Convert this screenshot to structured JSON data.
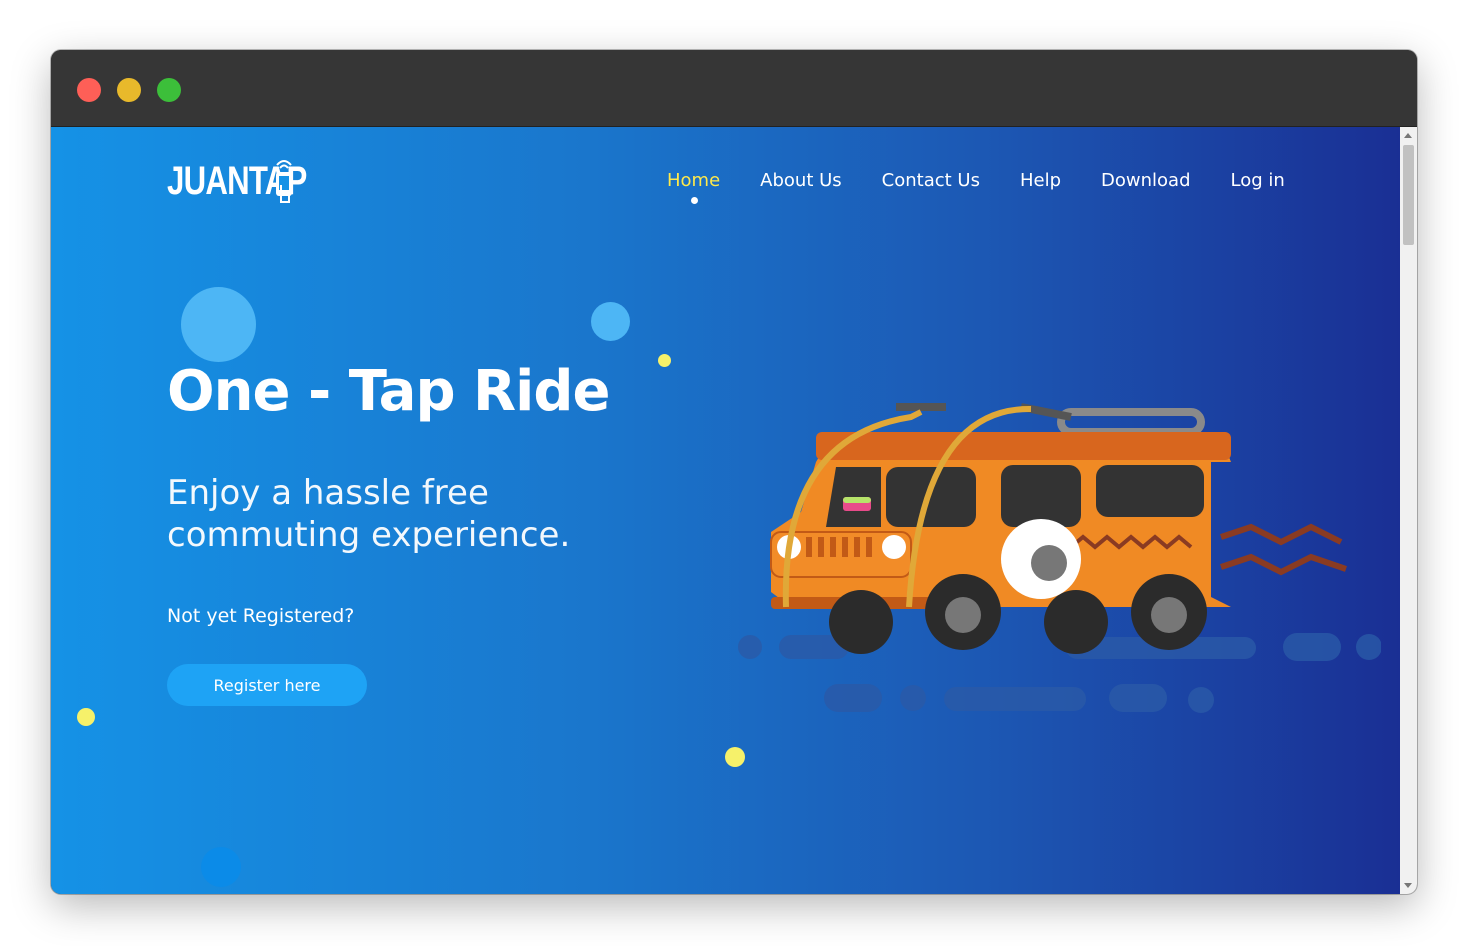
{
  "window": {
    "controls": [
      "close",
      "minimize",
      "maximize"
    ]
  },
  "brand": {
    "logo_text": "JUANTAP",
    "logo_icon": "tap-phone-icon"
  },
  "nav": {
    "items": [
      {
        "label": "Home",
        "active": true
      },
      {
        "label": "About Us",
        "active": false
      },
      {
        "label": "Contact Us",
        "active": false
      },
      {
        "label": "Help",
        "active": false
      },
      {
        "label": "Download",
        "active": false
      },
      {
        "label": "Log in",
        "active": false
      }
    ]
  },
  "hero": {
    "title": "One - Tap Ride",
    "subtitle": "Enjoy a hassle free commuting experience.",
    "register_prompt": "Not yet Registered?",
    "register_button": "Register here",
    "illustration": "jeepney-illustration"
  },
  "colors": {
    "accent_yellow": "#ffe94a",
    "button_blue": "#1ea3f5",
    "gradient_start": "#1592e6",
    "gradient_end": "#1a2f94",
    "jeep_orange": "#f08a24"
  }
}
